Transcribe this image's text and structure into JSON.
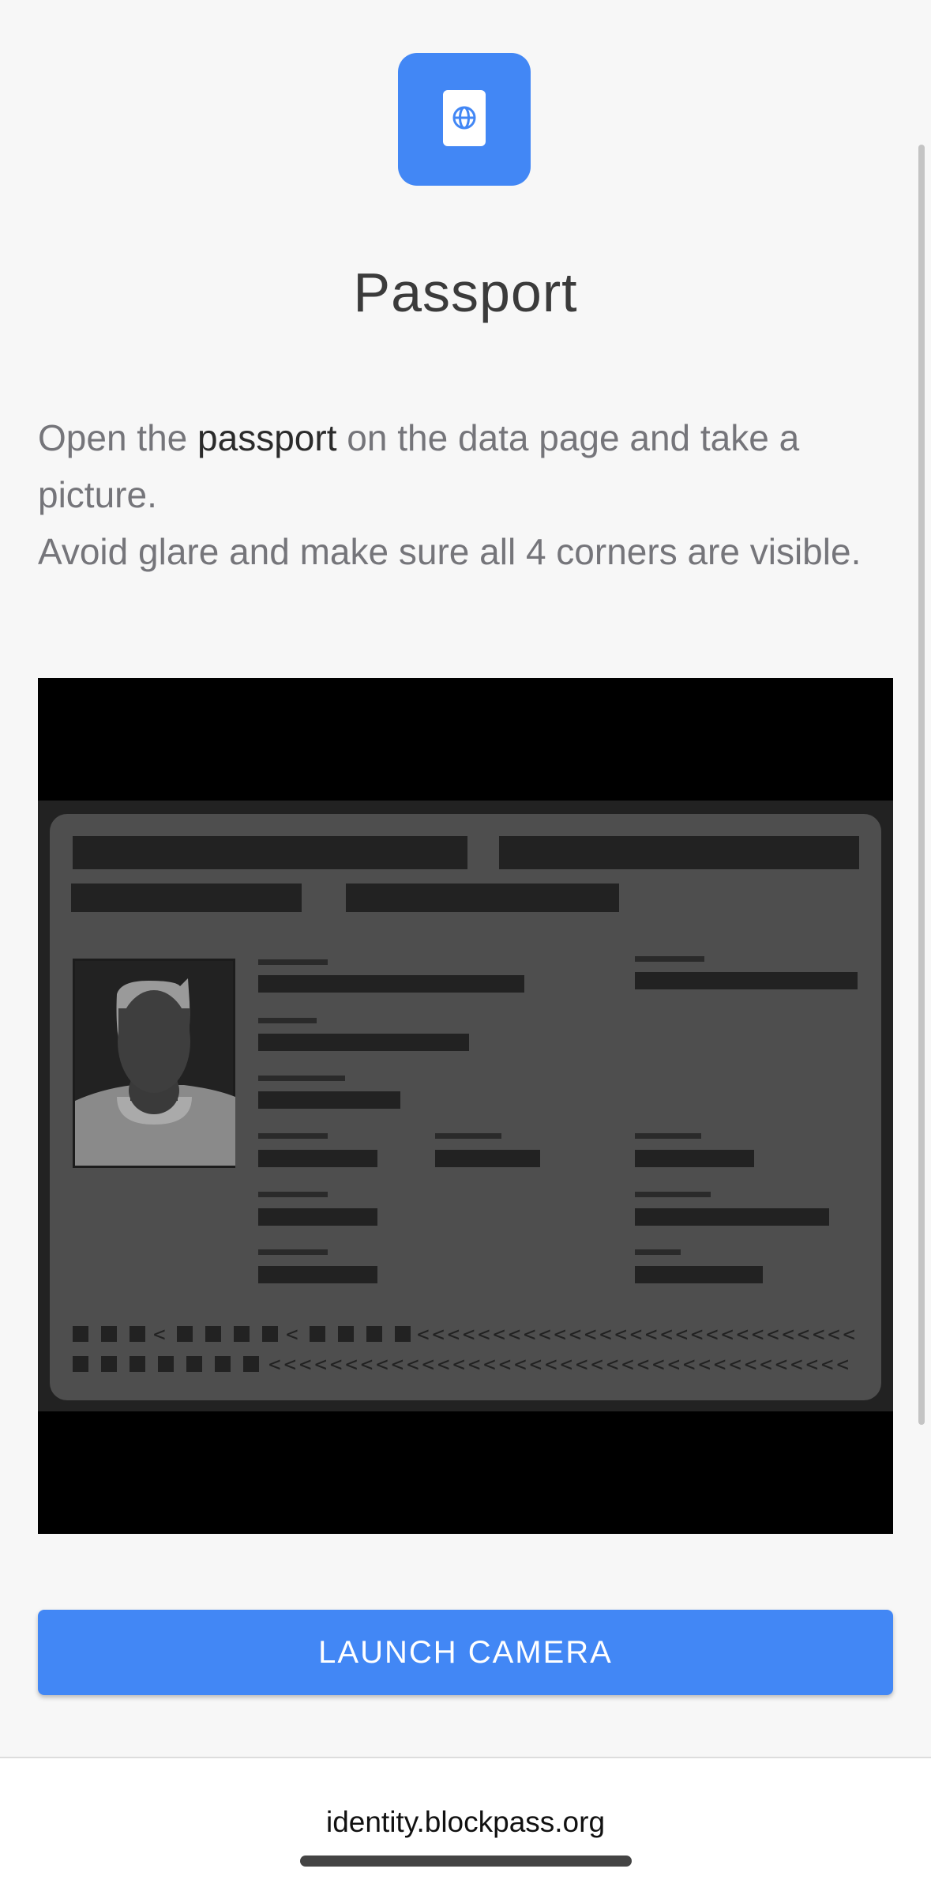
{
  "header": {
    "icon": "passport-icon",
    "title": "Passport"
  },
  "instructions": {
    "line1_prefix": "Open the ",
    "line1_emphasis": "passport",
    "line1_suffix": " on the data page and take a picture.",
    "line2": "Avoid glare and make sure all 4 corners are visible."
  },
  "preview": {
    "icon": "passport-sample-image"
  },
  "actions": {
    "launch_camera_label": "LAUNCH CAMERA"
  },
  "browser": {
    "url": "identity.blockpass.org"
  },
  "colors": {
    "accent": "#4287f5",
    "background": "#f7f7f7"
  }
}
